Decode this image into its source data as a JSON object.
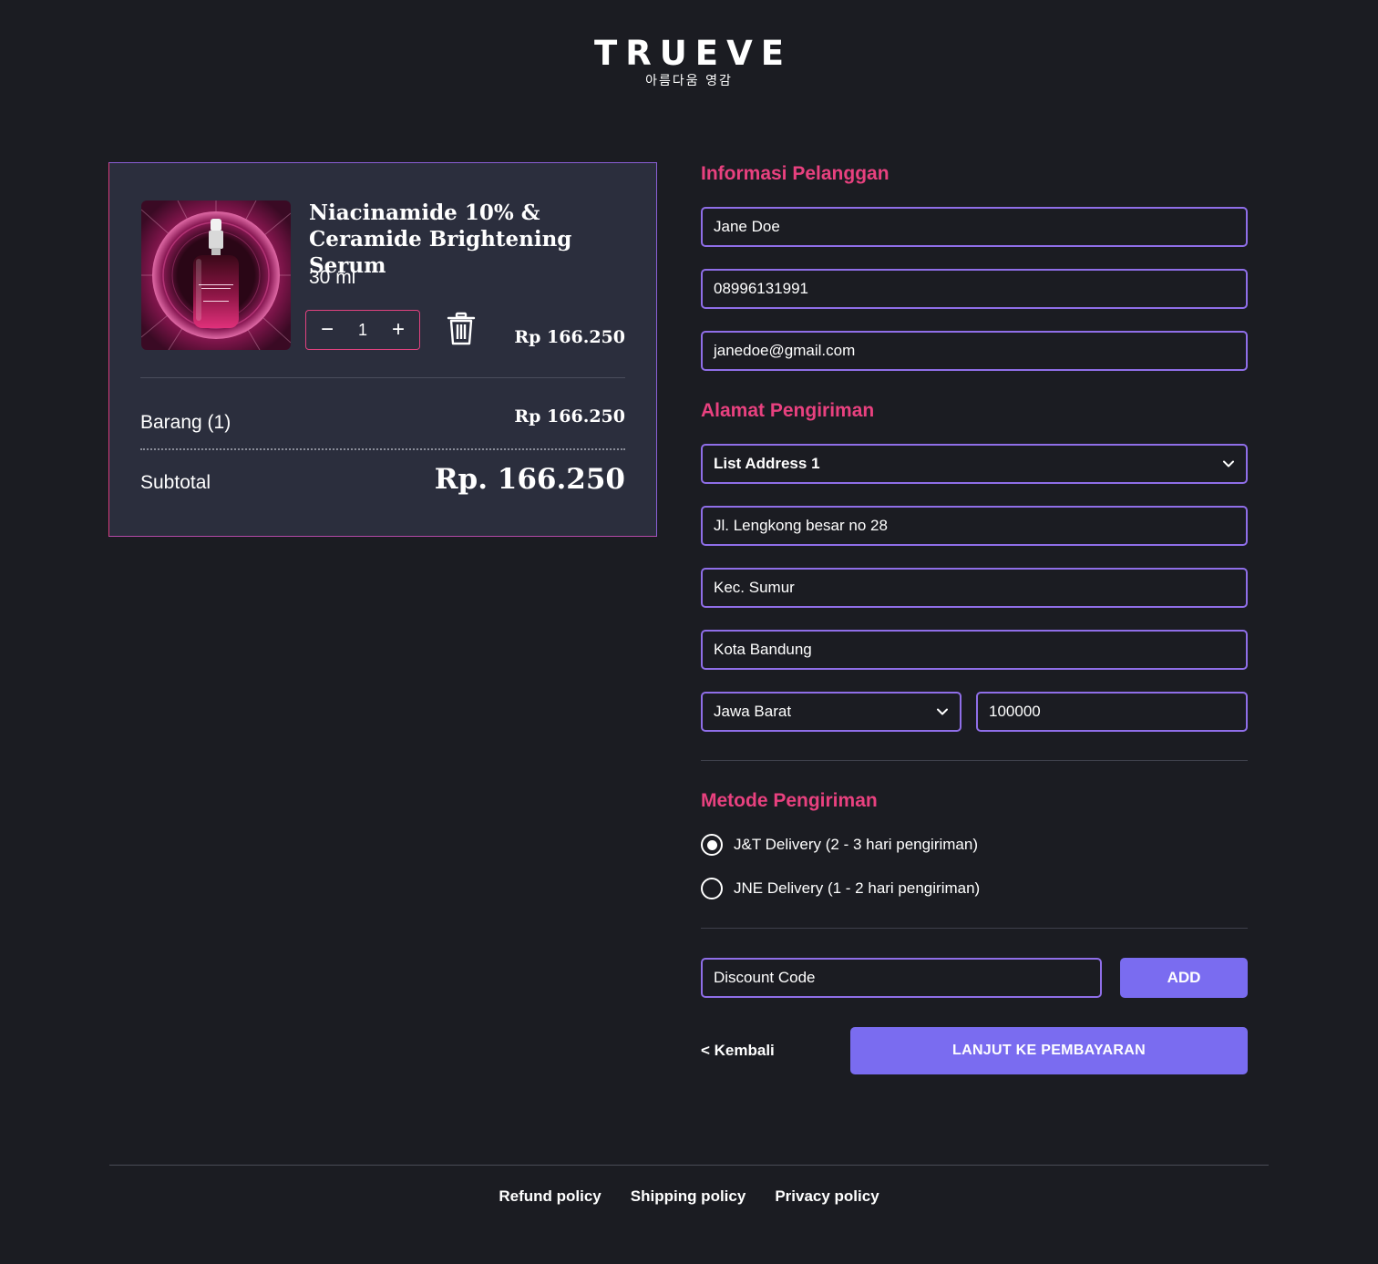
{
  "brand": {
    "name": "TRUEVE",
    "tagline": "아름다움 영감"
  },
  "cart": {
    "product": {
      "name": "Niacinamide 10% & Ceramide Brightening Serum",
      "size": "30 ml",
      "quantity": "1",
      "price": "Rp 166.250",
      "image_icon": "serum-bottle-image"
    },
    "summary": {
      "items_label": "Barang (1)",
      "items_price": "Rp 166.250",
      "subtotal_label": "Subtotal",
      "subtotal_price": "Rp. 166.250"
    }
  },
  "customer": {
    "title": "Informasi Pelanggan",
    "name": "Jane Doe",
    "phone": "08996131991",
    "email": "janedoe@gmail.com"
  },
  "address": {
    "title": "Alamat Pengiriman",
    "selected_address": "List Address 1",
    "street": "Jl. Lengkong besar no 28",
    "district": "Kec. Sumur",
    "city": "Kota Bandung",
    "province": "Jawa Barat",
    "postal_code": "100000"
  },
  "shipping": {
    "title": "Metode Pengiriman",
    "options": [
      {
        "label": "J&T Delivery (2 - 3 hari pengiriman)",
        "selected": true
      },
      {
        "label": "JNE Delivery (1 - 2 hari pengiriman)",
        "selected": false
      }
    ]
  },
  "discount": {
    "placeholder": "Discount Code",
    "add_label": "ADD"
  },
  "actions": {
    "back_label": "< Kembali",
    "next_label": "LANJUT KE PEMBAYARAN"
  },
  "footer": {
    "links": [
      "Refund policy",
      "Shipping policy",
      "Privacy policy"
    ]
  },
  "colors": {
    "background": "#1b1c22",
    "card": "#2b2e3d",
    "accent_pink": "#e8417f",
    "accent_purple": "#7a6cf0",
    "field_border": "#8f6ee8"
  }
}
